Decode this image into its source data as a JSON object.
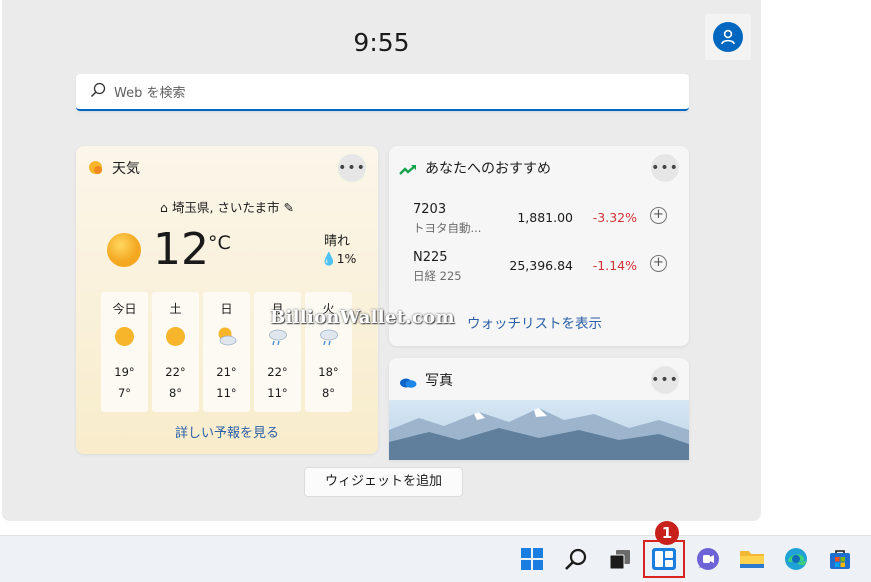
{
  "clock": "9:55",
  "search": {
    "placeholder": "Web を検索"
  },
  "weather": {
    "title": "天気",
    "location": "埼玉県, さいたま市",
    "temperature": "12",
    "unit": "°C",
    "condition": "晴れ",
    "precipitation": "1%",
    "forecast": [
      {
        "day": "今日",
        "icon": "sun-icon",
        "high": "19°",
        "low": "7°"
      },
      {
        "day": "土",
        "icon": "sun-icon",
        "high": "22°",
        "low": "8°"
      },
      {
        "day": "日",
        "icon": "partly-cloudy-icon",
        "high": "21°",
        "low": "11°"
      },
      {
        "day": "月",
        "icon": "rain-cloud-icon",
        "high": "22°",
        "low": "11°"
      },
      {
        "day": "火",
        "icon": "rain-cloud-icon",
        "high": "18°",
        "low": "8°"
      }
    ],
    "more_link": "詳しい予報を見る"
  },
  "recommendations": {
    "title": "あなたへのおすすめ",
    "stocks": [
      {
        "symbol": "7203",
        "name": "トヨタ自動...",
        "price": "1,881.00",
        "change": "-3.32%"
      },
      {
        "symbol": "N225",
        "name": "日経 225",
        "price": "25,396.84",
        "change": "-1.14%"
      }
    ],
    "watchlist_link": "ウォッチリストを表示"
  },
  "photos": {
    "title": "写真"
  },
  "add_widget_label": "ウィジェットを追加",
  "watermark": "BillionWallet.com",
  "badge_number": "1",
  "colors": {
    "accent": "#0067c0",
    "negative": "#d13438",
    "highlight": "#d8231f",
    "link": "#2b5fa8"
  },
  "taskbar": {
    "icons": [
      "start-icon",
      "search-icon",
      "task-view-icon",
      "widgets-icon",
      "teams-chat-icon",
      "file-explorer-icon",
      "edge-icon",
      "store-icon"
    ]
  }
}
